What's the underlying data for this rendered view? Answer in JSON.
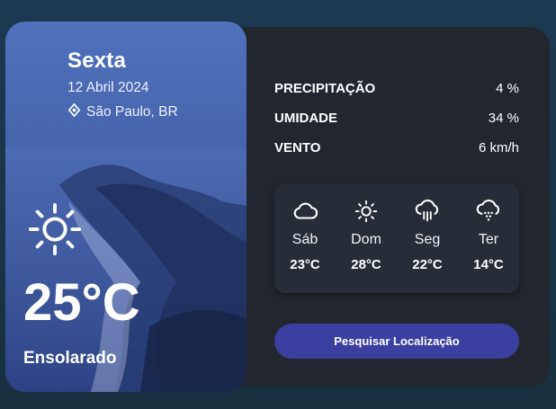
{
  "current": {
    "day": "Sexta",
    "date": "12 Abril 2024",
    "location": "São Paulo, BR",
    "temperature": "25°C",
    "condition": "Ensolarado",
    "icon": "sun-icon"
  },
  "stats": [
    {
      "label": "PRECIPITAÇÃO",
      "value": "4 %"
    },
    {
      "label": "UMIDADE",
      "value": "34 %"
    },
    {
      "label": "VENTO",
      "value": "6 km/h"
    }
  ],
  "forecast": [
    {
      "day": "Sáb",
      "temp": "23°C",
      "icon": "cloud-icon"
    },
    {
      "day": "Dom",
      "temp": "28°C",
      "icon": "sun-icon"
    },
    {
      "day": "Seg",
      "temp": "22°C",
      "icon": "cloud-rain-icon"
    },
    {
      "day": "Ter",
      "temp": "14°C",
      "icon": "cloud-snow-icon"
    }
  ],
  "search_button": {
    "label": "Pesquisar Localização"
  },
  "colors": {
    "accent": "#3a3fa0",
    "panel": "#22272f",
    "background": "#1b3a52"
  }
}
